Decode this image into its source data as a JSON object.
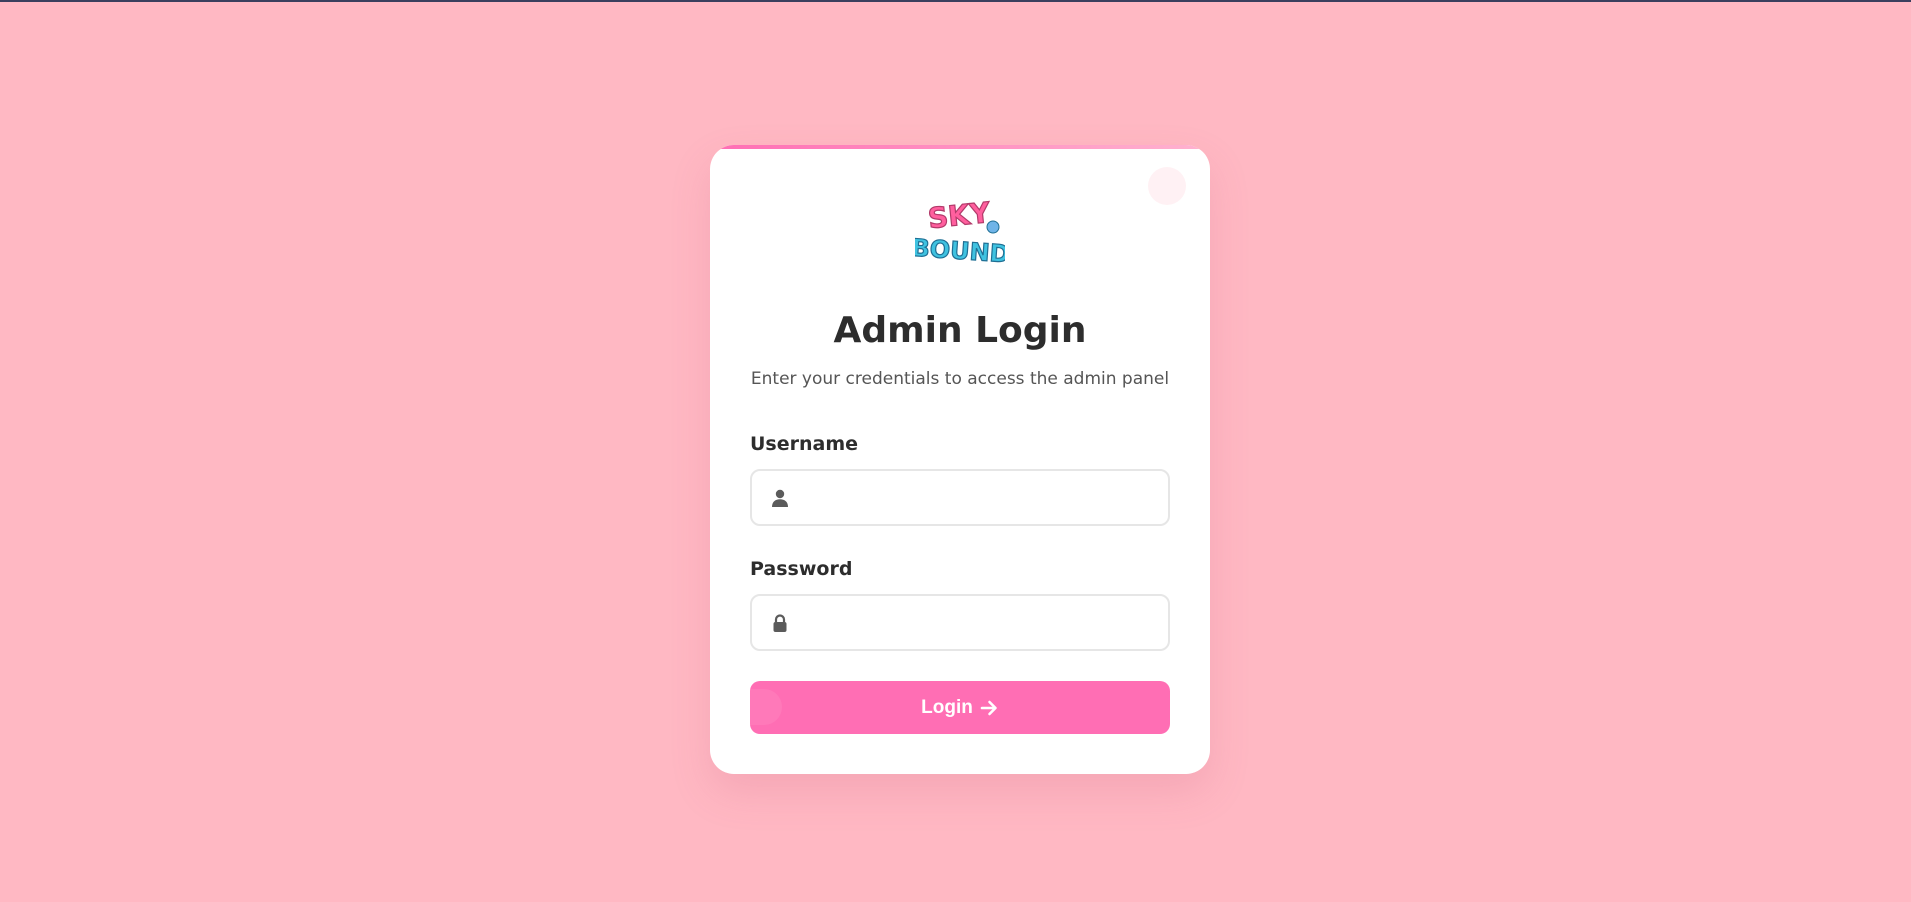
{
  "page": {
    "background_color": "#ffb8c3",
    "accent_color": "#ff6eb4"
  },
  "logo": {
    "text_line1": "SKY",
    "text_line2": "BOUND",
    "icon": "skybound-logo"
  },
  "login": {
    "title": "Admin Login",
    "subtitle": "Enter your credentials to access the admin panel",
    "username_label": "Username",
    "username_value": "",
    "username_placeholder": "",
    "username_icon": "user-icon",
    "password_label": "Password",
    "password_value": "",
    "password_placeholder": "",
    "password_icon": "lock-icon",
    "button_label": "Login",
    "button_icon": "arrow-right-icon"
  }
}
